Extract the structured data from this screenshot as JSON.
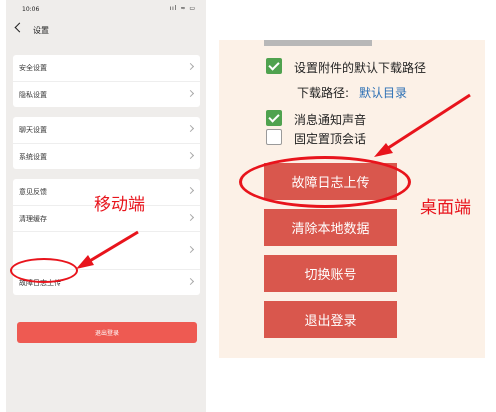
{
  "mobile": {
    "status_time": "10:06",
    "status_icons": "ııl ≈ ▭",
    "nav_title": "设置",
    "groups": [
      [
        "安全设置",
        "隐私设置"
      ],
      [
        "聊天设置",
        "系统设置"
      ],
      [
        "意见反馈",
        "清理缓存",
        "",
        "故障日志上传"
      ]
    ],
    "logout_label": "退出登录"
  },
  "desktop": {
    "opt_download_path": "设置附件的默认下载路径",
    "download_path_label": "下载路径:",
    "download_path_value": "默认目录",
    "opt_notify_sound": "消息通知声音",
    "opt_pin_chat": "固定置顶会话",
    "btn_upload_log": "故障日志上传",
    "btn_clear_data": "清除本地数据",
    "btn_switch_account": "切换账号",
    "btn_logout": "退出登录"
  },
  "annotations": {
    "mobile_label": "移动端",
    "desktop_label": "桌面端",
    "color": "#e8141c"
  }
}
